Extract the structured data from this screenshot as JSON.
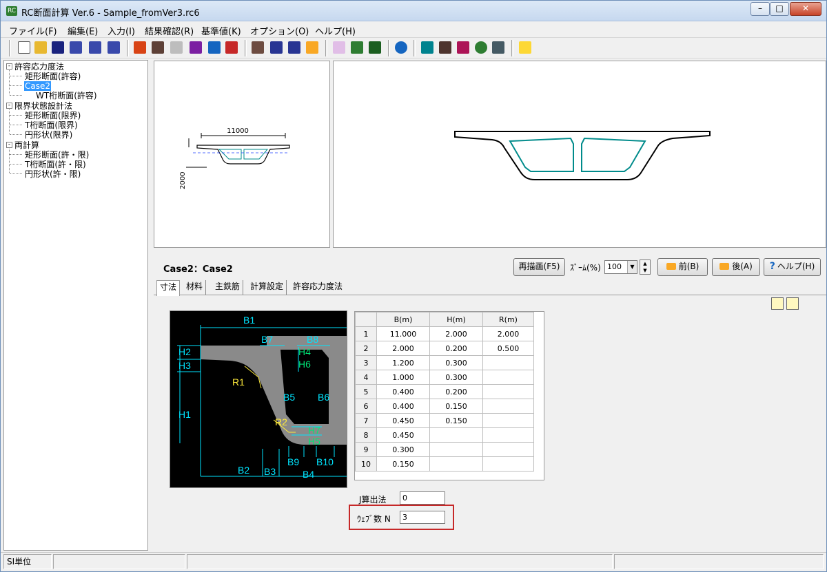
{
  "window": {
    "title": "RC断面計算 Ver.6 - Sample_fromVer3.rc6",
    "min_label": "–",
    "max_label": "□",
    "close_label": "✕"
  },
  "menu": [
    "ファイル(F)",
    "編集(E)",
    "入力(I)",
    "結果確認(R)",
    "基準値(K)",
    "オプション(O)",
    "ヘルプ(H)"
  ],
  "toolbar_icons": [
    "new-icon",
    "open-icon",
    "save-icon",
    "print-icon",
    "print-preview-icon",
    "print-setup-icon",
    "input-icon",
    "cut-icon",
    "copy-icon",
    "paste-icon",
    "insert-icon",
    "delete-icon",
    "table-icon",
    "grid-icon",
    "list-icon",
    "calc-icon",
    "chart-icon",
    "compare-icon",
    "result-icon",
    "globe-icon",
    "settings-icon",
    "monitor-icon",
    "report-icon",
    "refresh-icon",
    "tree-icon",
    "help-icon"
  ],
  "tree": {
    "groups": [
      {
        "label": "許容応力度法",
        "items": [
          "矩形断面(許容)",
          "Case2",
          "WT桁断面(許容)"
        ]
      },
      {
        "label": "限界状態設計法",
        "items": [
          "矩形断面(限界)",
          "T桁断面(限界)",
          "円形状(限界)"
        ]
      },
      {
        "label": "両計算",
        "items": [
          "矩形断面(許・限)",
          "T桁断面(許・限)",
          "円形状(許・限)"
        ]
      }
    ],
    "selected": "Case2"
  },
  "preview_small": {
    "width_label": "11000",
    "height_label": "2000"
  },
  "case_title": "Case2：Case2",
  "buttons": {
    "redraw": "再描画(F5)",
    "zoom_label": "ｽﾞｰﾑ(%)",
    "zoom_value": "100",
    "prev": "前(B)",
    "next": "後(A)",
    "help": "ヘルプ(H)"
  },
  "tabs": [
    "寸法",
    "材料",
    "主鉄筋",
    "計算設定",
    "許容応力度法"
  ],
  "active_tab": "寸法",
  "diagram_labels": [
    "B1",
    "B7",
    "B8",
    "H2",
    "H4",
    "H3",
    "H6",
    "R1",
    "B5",
    "B6",
    "H1",
    "R2",
    "H7",
    "H5",
    "B9",
    "B10",
    "B2",
    "B3",
    "B4"
  ],
  "grid": {
    "columns": [
      "B(m)",
      "H(m)",
      "R(m)"
    ],
    "rows": [
      {
        "n": "1",
        "b": "11.000",
        "h": "2.000",
        "r": "2.000"
      },
      {
        "n": "2",
        "b": "2.000",
        "h": "0.200",
        "r": "0.500"
      },
      {
        "n": "3",
        "b": "1.200",
        "h": "0.300",
        "r": ""
      },
      {
        "n": "4",
        "b": "1.000",
        "h": "0.300",
        "r": ""
      },
      {
        "n": "5",
        "b": "0.400",
        "h": "0.200",
        "r": ""
      },
      {
        "n": "6",
        "b": "0.400",
        "h": "0.150",
        "r": ""
      },
      {
        "n": "7",
        "b": "0.450",
        "h": "0.150",
        "r": ""
      },
      {
        "n": "8",
        "b": "0.450",
        "h": "",
        "r": ""
      },
      {
        "n": "9",
        "b": "0.300",
        "h": "",
        "r": ""
      },
      {
        "n": "10",
        "b": "0.150",
        "h": "",
        "r": ""
      }
    ]
  },
  "fields": {
    "j_method_label": "J算出法",
    "j_method_value": "0",
    "web_count_label": "ｳｪﾌﾞ数 N",
    "web_count_value": "3"
  },
  "status": {
    "unit": "SI単位"
  },
  "colors": {
    "section_outline": "#000000",
    "cell_outline": "#008b8b",
    "diagram_bg": "#000000",
    "diagram_dim": "#00e5ff",
    "diagram_fill": "#8a8a8a",
    "highlight_box": "#c62828",
    "selection": "#3399ff"
  }
}
